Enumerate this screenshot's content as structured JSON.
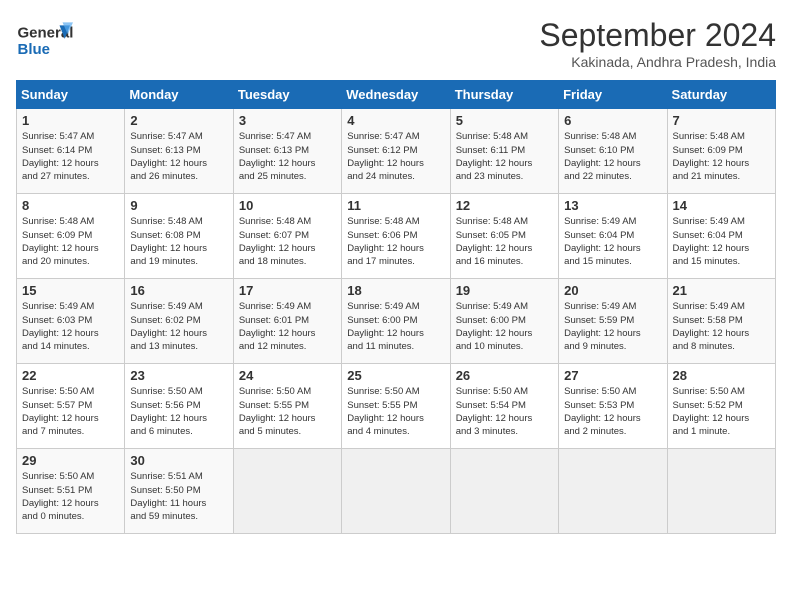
{
  "header": {
    "logo_general": "General",
    "logo_blue": "Blue",
    "month_title": "September 2024",
    "subtitle": "Kakinada, Andhra Pradesh, India"
  },
  "days_of_week": [
    "Sunday",
    "Monday",
    "Tuesday",
    "Wednesday",
    "Thursday",
    "Friday",
    "Saturday"
  ],
  "weeks": [
    [
      {
        "day": "1",
        "sunrise": "5:47 AM",
        "sunset": "6:14 PM",
        "daylight": "12 hours and 27 minutes."
      },
      {
        "day": "2",
        "sunrise": "5:47 AM",
        "sunset": "6:13 PM",
        "daylight": "12 hours and 26 minutes."
      },
      {
        "day": "3",
        "sunrise": "5:47 AM",
        "sunset": "6:13 PM",
        "daylight": "12 hours and 25 minutes."
      },
      {
        "day": "4",
        "sunrise": "5:47 AM",
        "sunset": "6:12 PM",
        "daylight": "12 hours and 24 minutes."
      },
      {
        "day": "5",
        "sunrise": "5:48 AM",
        "sunset": "6:11 PM",
        "daylight": "12 hours and 23 minutes."
      },
      {
        "day": "6",
        "sunrise": "5:48 AM",
        "sunset": "6:10 PM",
        "daylight": "12 hours and 22 minutes."
      },
      {
        "day": "7",
        "sunrise": "5:48 AM",
        "sunset": "6:09 PM",
        "daylight": "12 hours and 21 minutes."
      }
    ],
    [
      {
        "day": "8",
        "sunrise": "5:48 AM",
        "sunset": "6:09 PM",
        "daylight": "12 hours and 20 minutes."
      },
      {
        "day": "9",
        "sunrise": "5:48 AM",
        "sunset": "6:08 PM",
        "daylight": "12 hours and 19 minutes."
      },
      {
        "day": "10",
        "sunrise": "5:48 AM",
        "sunset": "6:07 PM",
        "daylight": "12 hours and 18 minutes."
      },
      {
        "day": "11",
        "sunrise": "5:48 AM",
        "sunset": "6:06 PM",
        "daylight": "12 hours and 17 minutes."
      },
      {
        "day": "12",
        "sunrise": "5:48 AM",
        "sunset": "6:05 PM",
        "daylight": "12 hours and 16 minutes."
      },
      {
        "day": "13",
        "sunrise": "5:49 AM",
        "sunset": "6:04 PM",
        "daylight": "12 hours and 15 minutes."
      },
      {
        "day": "14",
        "sunrise": "5:49 AM",
        "sunset": "6:04 PM",
        "daylight": "12 hours and 15 minutes."
      }
    ],
    [
      {
        "day": "15",
        "sunrise": "5:49 AM",
        "sunset": "6:03 PM",
        "daylight": "12 hours and 14 minutes."
      },
      {
        "day": "16",
        "sunrise": "5:49 AM",
        "sunset": "6:02 PM",
        "daylight": "12 hours and 13 minutes."
      },
      {
        "day": "17",
        "sunrise": "5:49 AM",
        "sunset": "6:01 PM",
        "daylight": "12 hours and 12 minutes."
      },
      {
        "day": "18",
        "sunrise": "5:49 AM",
        "sunset": "6:00 PM",
        "daylight": "12 hours and 11 minutes."
      },
      {
        "day": "19",
        "sunrise": "5:49 AM",
        "sunset": "6:00 PM",
        "daylight": "12 hours and 10 minutes."
      },
      {
        "day": "20",
        "sunrise": "5:49 AM",
        "sunset": "5:59 PM",
        "daylight": "12 hours and 9 minutes."
      },
      {
        "day": "21",
        "sunrise": "5:49 AM",
        "sunset": "5:58 PM",
        "daylight": "12 hours and 8 minutes."
      }
    ],
    [
      {
        "day": "22",
        "sunrise": "5:50 AM",
        "sunset": "5:57 PM",
        "daylight": "12 hours and 7 minutes."
      },
      {
        "day": "23",
        "sunrise": "5:50 AM",
        "sunset": "5:56 PM",
        "daylight": "12 hours and 6 minutes."
      },
      {
        "day": "24",
        "sunrise": "5:50 AM",
        "sunset": "5:55 PM",
        "daylight": "12 hours and 5 minutes."
      },
      {
        "day": "25",
        "sunrise": "5:50 AM",
        "sunset": "5:55 PM",
        "daylight": "12 hours and 4 minutes."
      },
      {
        "day": "26",
        "sunrise": "5:50 AM",
        "sunset": "5:54 PM",
        "daylight": "12 hours and 3 minutes."
      },
      {
        "day": "27",
        "sunrise": "5:50 AM",
        "sunset": "5:53 PM",
        "daylight": "12 hours and 2 minutes."
      },
      {
        "day": "28",
        "sunrise": "5:50 AM",
        "sunset": "5:52 PM",
        "daylight": "12 hours and 1 minute."
      }
    ],
    [
      {
        "day": "29",
        "sunrise": "5:50 AM",
        "sunset": "5:51 PM",
        "daylight": "12 hours and 0 minutes."
      },
      {
        "day": "30",
        "sunrise": "5:51 AM",
        "sunset": "5:50 PM",
        "daylight": "11 hours and 59 minutes."
      },
      null,
      null,
      null,
      null,
      null
    ]
  ],
  "labels": {
    "sunrise": "Sunrise:",
    "sunset": "Sunset:",
    "daylight": "Daylight:"
  }
}
